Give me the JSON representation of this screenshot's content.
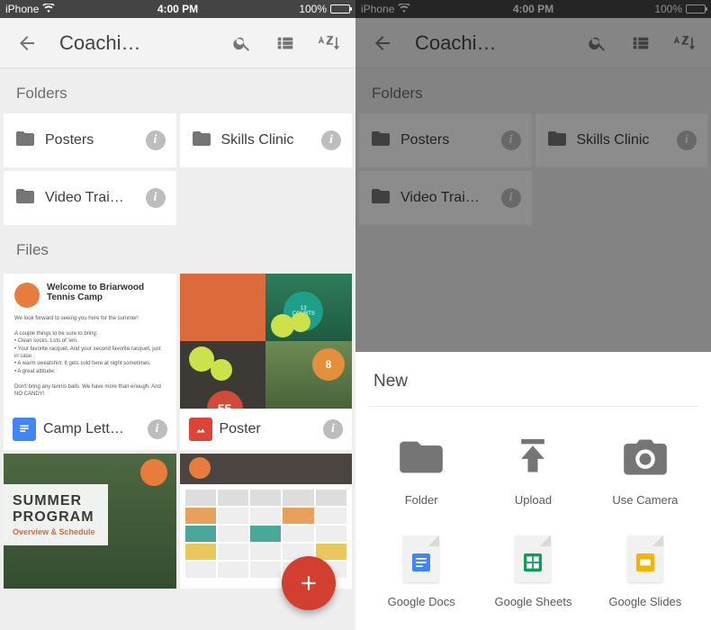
{
  "status": {
    "carrier": "iPhone",
    "time": "4:00 PM",
    "battery": "100%"
  },
  "appbar": {
    "title": "Coachi…"
  },
  "sections": {
    "folders": "Folders",
    "files": "Files"
  },
  "folders": [
    {
      "name": "Posters"
    },
    {
      "name": "Skills Clinic"
    },
    {
      "name": "Video Trai…"
    }
  ],
  "files": [
    {
      "name": "Camp Lett…",
      "type": "docs"
    },
    {
      "name": "Poster",
      "type": "image"
    }
  ],
  "thumb_camp": {
    "title": "Welcome to Briarwood Tennis Camp"
  },
  "thumb_poster": {
    "n1": "13",
    "n1s": "COURTS",
    "n2": "8",
    "n3": "55"
  },
  "thumb_summer": {
    "l1": "SUMMER",
    "l2": "PROGRAM",
    "l3": "Overview & Schedule"
  },
  "sheet": {
    "title": "New",
    "items": [
      {
        "label": "Folder"
      },
      {
        "label": "Upload"
      },
      {
        "label": "Use Camera"
      },
      {
        "label": "Google Docs"
      },
      {
        "label": "Google Sheets"
      },
      {
        "label": "Google Slides"
      }
    ]
  }
}
